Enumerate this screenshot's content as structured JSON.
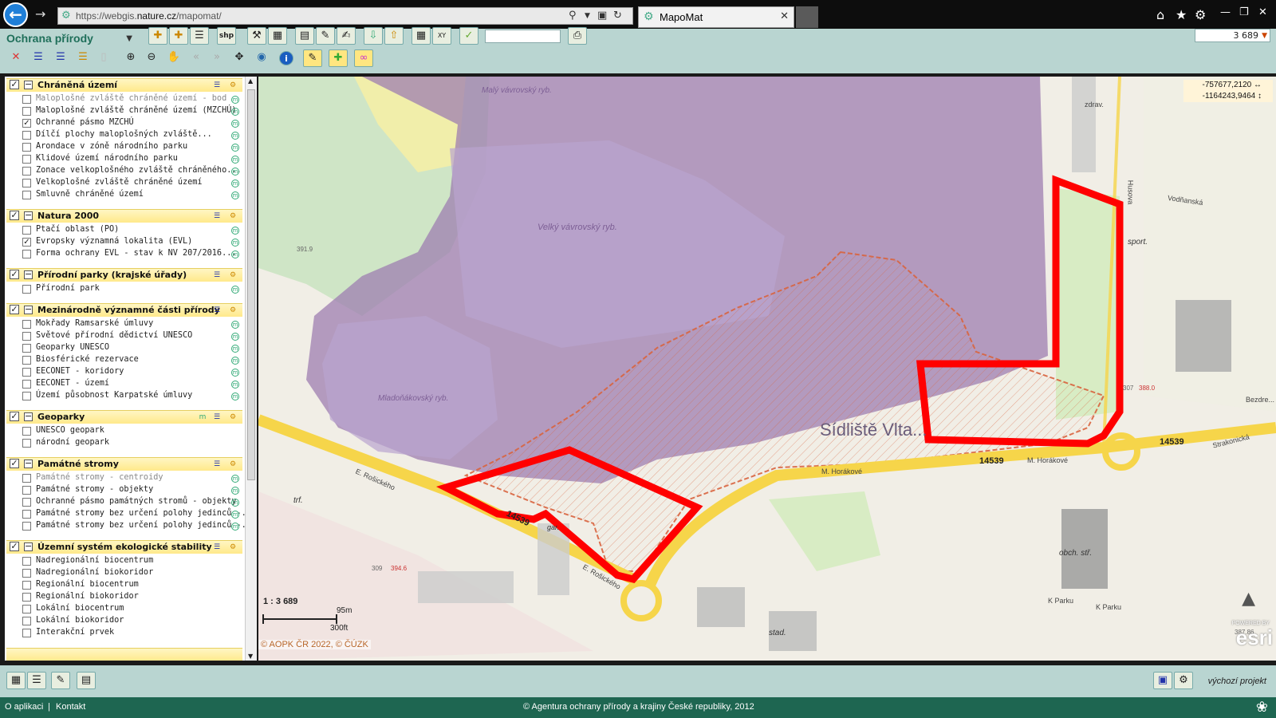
{
  "browser": {
    "url_prefix": "https://webgis.",
    "url_domain": "nature.cz",
    "url_path": "/mapomat/",
    "tab_title": "MapoMat"
  },
  "toolbar": {
    "theme": "Ochrana přírody",
    "scale_value": "3 689",
    "search_placeholder": ""
  },
  "groups": [
    {
      "title": "Chráněná území",
      "checked": true,
      "layers": [
        {
          "label": "Maloplošné zvláště chráněné území - bod",
          "checked": false,
          "dim": true
        },
        {
          "label": "Maloplošné zvláště chráněné území (MZCHÚ)",
          "checked": false
        },
        {
          "label": "Ochranné pásmo MZCHÚ",
          "checked": true
        },
        {
          "label": "Dílčí plochy maloplošných zvláště...",
          "checked": false
        },
        {
          "label": "Arondace v zóně národního parku",
          "checked": false
        },
        {
          "label": "Klidové území národního parku",
          "checked": false
        },
        {
          "label": "Zonace velkoplošného zvláště chráněného...",
          "checked": false
        },
        {
          "label": "Velkoplošné zvláště chráněné území",
          "checked": false
        },
        {
          "label": "Smluvně chráněné území",
          "checked": false
        }
      ]
    },
    {
      "title": "Natura 2000",
      "checked": true,
      "layers": [
        {
          "label": "Ptačí oblast (PO)",
          "checked": false
        },
        {
          "label": "Evropsky významná lokalita (EVL)",
          "checked": true
        },
        {
          "label": "Forma ochrany EVL - stav k NV 207/2016...",
          "checked": false
        }
      ]
    },
    {
      "title": "Přírodní parky (krajské úřady)",
      "checked": true,
      "layers": [
        {
          "label": "Přírodní park",
          "checked": false
        }
      ]
    },
    {
      "title": "Mezinárodně významné části přírody",
      "checked": true,
      "layers": [
        {
          "label": "Mokřady Ramsarské úmluvy",
          "checked": false
        },
        {
          "label": "Světové přírodní dědictví UNESCO",
          "checked": false
        },
        {
          "label": "Geoparky UNESCO",
          "checked": false
        },
        {
          "label": "Biosférické rezervace",
          "checked": false
        },
        {
          "label": "EECONET - koridory",
          "checked": false
        },
        {
          "label": "EECONET - území",
          "checked": false
        },
        {
          "label": "Území působnost Karpatské úmluvy",
          "checked": false
        }
      ]
    },
    {
      "title": "Geoparky",
      "checked": true,
      "layers": [
        {
          "label": "UNESCO geopark",
          "checked": false
        },
        {
          "label": "národní geopark",
          "checked": false
        }
      ]
    },
    {
      "title": "Památné stromy",
      "checked": true,
      "layers": [
        {
          "label": "Památné stromy - centroidy",
          "checked": false,
          "dim": true
        },
        {
          "label": "Památné stromy - objekty",
          "checked": false
        },
        {
          "label": "Ochranné pásmo památných stromů - objekty",
          "checked": false
        },
        {
          "label": "Památné stromy bez určení polohy jedinců -...",
          "checked": false
        },
        {
          "label": "Památné stromy bez určení polohy jedinců -...",
          "checked": false
        }
      ]
    },
    {
      "title": "Územní systém ekologické stability",
      "checked": true,
      "layers": [
        {
          "label": "Nadregionální biocentrum",
          "checked": false
        },
        {
          "label": "Nadregionální biokoridor",
          "checked": false
        },
        {
          "label": "Regionální biocentrum",
          "checked": false
        },
        {
          "label": "Regionální biokoridor",
          "checked": false
        },
        {
          "label": "Lokální biocentrum",
          "checked": false
        },
        {
          "label": "Lokální biokoridor",
          "checked": false
        },
        {
          "label": "Interakční prvek",
          "checked": false
        }
      ]
    }
  ],
  "map": {
    "coord_x": "-757677,2120",
    "coord_y": "-1164243,9464",
    "scale_ratio": "1 : 3 689",
    "scalebar_m": "95m",
    "scalebar_ft": "300ft",
    "copyright": "© AOPK ČR 2022, © ČÚZK",
    "esri": "esri",
    "powered_by": "POWERED BY",
    "labels": {
      "maly": "Malý vávrovský ryb.",
      "velky": "Velký vávrovský ryb.",
      "mladon": "Mladoňákovský ryb.",
      "sidliste": "Sídliště Vlta...",
      "road1": "14539",
      "road2": "14539",
      "road3": "14539",
      "horakove": "M. Horákové",
      "rosickeho": "E. Rošického",
      "rosickeho2": "E. Rošického",
      "sport": "sport.",
      "obch": "obch. stř.",
      "trf": "trf.",
      "gar": "gar.",
      "stad": "stad.",
      "kparku": "K Parku",
      "kparku2": "K Parku",
      "strakonicka": "Strakonická",
      "husova": "Husova",
      "vodnanska": "Vodňanská",
      "zdrav": "zdrav.",
      "bezdre": "Bezdre...",
      "elev1": "391.9",
      "elev2": "309",
      "elev3": "394.6",
      "elev4": "307",
      "elev5": "388.0",
      "elev6": "387.86"
    }
  },
  "status": {
    "project": "výchozí projekt"
  },
  "footer": {
    "about": "O aplikaci",
    "sep": "|",
    "contact": "Kontakt",
    "copyright": "© Agentura ochrany přírody a krajiny České republiky, 2012"
  },
  "colors": {
    "toolbar_bg": "#b9d5d1",
    "footer_bg": "#1e6651",
    "highlight": "#ff0000",
    "protected_zone": "#9d7db0"
  }
}
